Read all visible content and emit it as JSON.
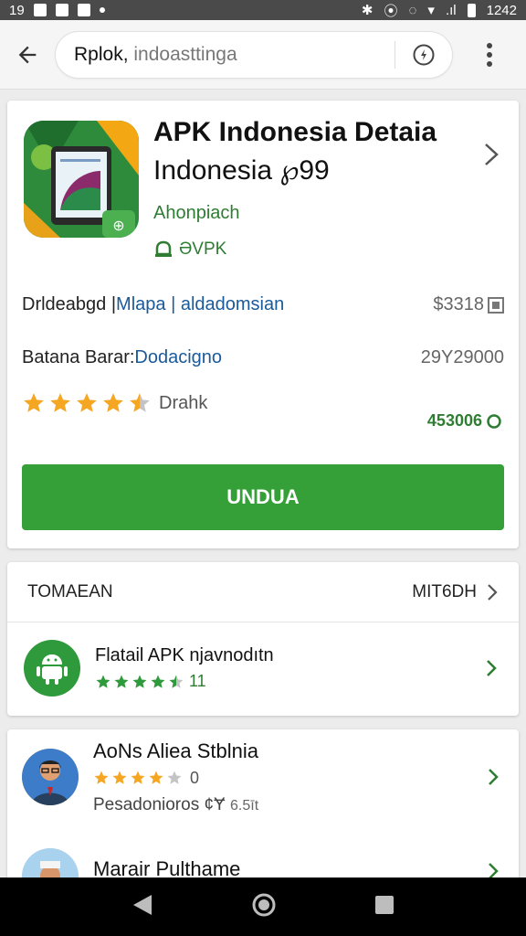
{
  "status_bar": {
    "time_left": "19",
    "time_right": "1242",
    "signal": ".ıl"
  },
  "toolbar": {
    "url_path": "Rplok,",
    "url_host": " indoasttinga",
    "back_icon": "arrow-left-icon",
    "menu_icon": "more-vert-icon"
  },
  "app": {
    "title_line1": "APK Indonesia Detaia",
    "title_line2": "Indonesia ℘99",
    "developer": "Ahonpiach",
    "badge_text": "ƏVPK",
    "info_row": {
      "prefix": "Drldeabgd | ",
      "link": "Mlapa | aldadomsian",
      "end_value": "$3318"
    },
    "category_row": {
      "label": "Batana Barar: ",
      "link": "Dodacigno",
      "end_value": "29Y29000"
    },
    "rating": {
      "value": 4.5,
      "max": 5,
      "label": "Drahk"
    },
    "downloads": "453006",
    "install_label": "UNDUA",
    "accent_color": "#35a038"
  },
  "similar": {
    "header_left": "TOMAEAN",
    "header_right": "MIT6DH",
    "items": [
      {
        "title": "Flatail APK njavnodıtn",
        "rating": 4.5,
        "count": "11"
      }
    ]
  },
  "apps": [
    {
      "title": "AoNs Aliea Stblnia",
      "rating": 4,
      "count": "0",
      "subtitle": "Pesadonioros ¢Ɏ",
      "subvalue": "6.5īt"
    },
    {
      "title": "Marair Pulthame"
    }
  ]
}
